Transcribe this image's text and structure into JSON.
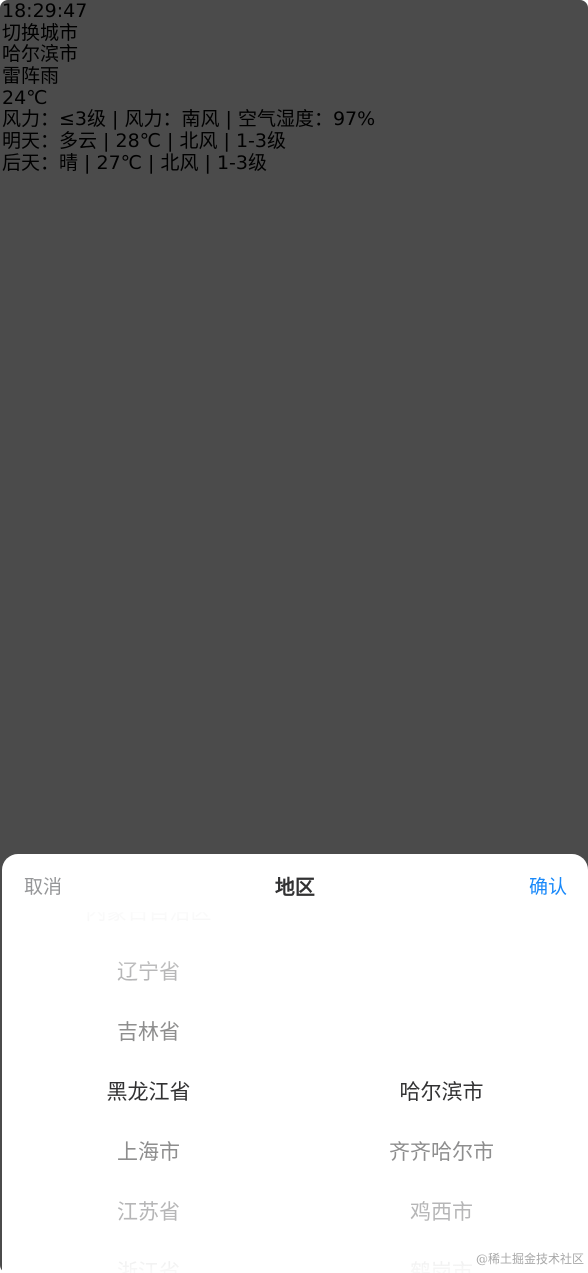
{
  "weather": {
    "time": "18:29:47",
    "switch_city": "切换城市",
    "city": "哈尔滨市",
    "condition": "雷阵雨",
    "temperature": "24℃",
    "details": "风力：≤3级 | 风力：南风 | 空气湿度：97%",
    "tomorrow": "明天：多云 | 28℃ | 北风 | 1-3级",
    "day_after": "后天：晴 | 27℃ | 北风 | 1-3级"
  },
  "picker": {
    "cancel_label": "取消",
    "title": "地区",
    "confirm_label": "确认",
    "provinces": [
      "内蒙古自治区",
      "辽宁省",
      "吉林省",
      "黑龙江省",
      "上海市",
      "江苏省",
      "浙江省"
    ],
    "cities": [
      "哈尔滨市",
      "齐齐哈尔市",
      "鸡西市",
      "鹤岗市"
    ],
    "selected_province": "黑龙江省",
    "selected_city": "哈尔滨市"
  },
  "watermark": "@稀土掘金技术社区",
  "colors": {
    "overlay": "#4b4b4b",
    "confirm": "#1989fa",
    "cancel": "#969799",
    "text": "#323233"
  }
}
